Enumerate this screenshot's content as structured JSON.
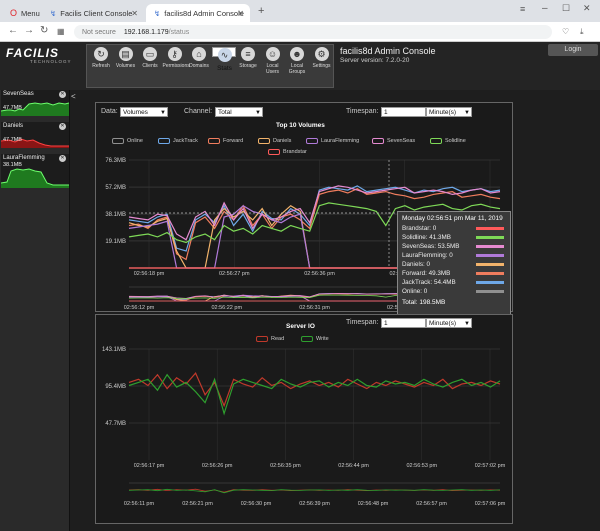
{
  "browser": {
    "tabs": [
      {
        "label": "Menu"
      },
      {
        "label": "Facilis Client Console"
      },
      {
        "label": "facilis8d Admin Console"
      }
    ],
    "new_tab": "+",
    "url_security": "Not secure",
    "url_host": "192.168.1.179",
    "url_path": "/status"
  },
  "header": {
    "logo": "FACILIS",
    "logo_sub": "TECHNOLOGY",
    "title": "facilis8d Admin Console",
    "version": "Server version: 7.2.0-20",
    "login": "Login",
    "tools": [
      {
        "label": "Refresh",
        "icon": "refresh-icon",
        "glyph": "↻"
      },
      {
        "label": "Volumes",
        "icon": "volumes-icon",
        "glyph": "▤"
      },
      {
        "label": "Clients",
        "icon": "clients-icon",
        "glyph": "▭"
      },
      {
        "label": "Permissions",
        "icon": "key-icon",
        "glyph": "⚷"
      },
      {
        "label": "Domains",
        "icon": "domains-icon",
        "glyph": "⌂"
      },
      {
        "label": "Stats",
        "icon": "stats-icon",
        "glyph": "∿"
      },
      {
        "label": "Storage",
        "icon": "storage-icon",
        "glyph": "≡"
      },
      {
        "label": "Local Users",
        "icon": "local-users-icon",
        "glyph": "☺"
      },
      {
        "label": "Local Groups",
        "icon": "local-groups-icon",
        "glyph": "☻"
      },
      {
        "label": "Settings",
        "icon": "settings-icon",
        "glyph": "⚙"
      }
    ]
  },
  "sidebar": {
    "items": [
      {
        "name": "SevenSeas",
        "value": "47.7MB"
      },
      {
        "name": "Daniels",
        "value": "47.7MB"
      },
      {
        "name": "LauraFlemming",
        "value": "38.1MB"
      }
    ],
    "collapse": "<"
  },
  "volumes_panel": {
    "data_label": "Data:",
    "data_value": "Volumes",
    "channel_label": "Channel:",
    "channel_value": "Total",
    "timespan_label": "Timespan:",
    "timespan_value": "1",
    "timespan_unit": "Minute(s)",
    "tooltip": {
      "title": "Monday 02:56:51 pm Mar 11, 2019",
      "rows": [
        {
          "text": "Brandstar: 0",
          "color": "#ff5a5a"
        },
        {
          "text": "Solidline: 41.3MB",
          "color": "#7ed957"
        },
        {
          "text": "SevenSeas: 53.5MB",
          "color": "#e58ad0"
        },
        {
          "text": "LauraFlemming: 0",
          "color": "#b07ad9"
        },
        {
          "text": "Daniels: 0",
          "color": "#f2b36b"
        },
        {
          "text": "Forward: 49.3MB",
          "color": "#f07d5e"
        },
        {
          "text": "JackTrack: 54.4MB",
          "color": "#6ea8e8"
        },
        {
          "text": "Online: 0",
          "color": "#909090"
        }
      ],
      "total": "Total: 198.5MB"
    }
  },
  "io_panel": {
    "timespan_label": "Timespan:",
    "timespan_value": "1",
    "timespan_unit": "Minute(s)"
  },
  "chart_data": [
    {
      "type": "line",
      "title": "Top 10 Volumes",
      "y_ticks": [
        "76.3MB",
        "57.2MB",
        "38.1MB",
        "19.1MB"
      ],
      "y_tick_values": [
        76.3,
        57.2,
        38.1,
        19.1
      ],
      "ylim": [
        0,
        76.3
      ],
      "x_ticks": [
        "02:56:18 pm",
        "02:56:27 pm",
        "02:56:36 pm",
        "02:56:45 pm",
        "02:56:54 pm"
      ],
      "overview_x_ticks": [
        "02:56:12 pm",
        "02:56:22 pm",
        "02:56:31 pm",
        "02:56:40 pm",
        "02:56:49 pm"
      ],
      "series": [
        {
          "name": "Online",
          "color": "#909090",
          "values": [
            0,
            0,
            0,
            0,
            0,
            0,
            0,
            0,
            0,
            0,
            0,
            0,
            0,
            0,
            0,
            0,
            0,
            0,
            0,
            0,
            0,
            0,
            0,
            0,
            0,
            0,
            0,
            0,
            0,
            0,
            0,
            0,
            0,
            0,
            0,
            0,
            0,
            0,
            0,
            0
          ]
        },
        {
          "name": "JackTrack",
          "color": "#6ea8e8",
          "values": [
            34,
            33,
            32,
            36,
            38,
            14,
            12,
            34,
            38,
            32,
            44,
            30,
            38,
            26,
            40,
            35,
            34,
            42,
            38,
            30,
            55,
            57,
            56,
            55,
            58,
            54,
            55,
            56,
            57,
            55,
            53,
            55,
            54,
            56,
            57,
            54,
            55,
            56,
            54,
            55
          ]
        },
        {
          "name": "Forward",
          "color": "#f07d5e",
          "values": [
            30,
            31,
            28,
            34,
            36,
            10,
            6,
            32,
            36,
            28,
            40,
            34,
            44,
            30,
            38,
            28,
            36,
            38,
            34,
            28,
            52,
            54,
            55,
            53,
            56,
            52,
            53,
            54,
            52,
            51,
            49,
            50,
            52,
            53,
            54,
            50,
            51,
            52,
            50,
            49
          ]
        },
        {
          "name": "Daniels",
          "color": "#f2b36b",
          "values": [
            32,
            30,
            29,
            33,
            35,
            12,
            0,
            0,
            0,
            34,
            42,
            36,
            40,
            34,
            42,
            30,
            38,
            44,
            40,
            0,
            0,
            0,
            0,
            0,
            0,
            0,
            0,
            0,
            0,
            0,
            0,
            0,
            0,
            0,
            0,
            0,
            0,
            0,
            0,
            0
          ]
        },
        {
          "name": "LauraFlemming",
          "color": "#b07ad9",
          "values": [
            28,
            29,
            30,
            31,
            33,
            0,
            0,
            0,
            0,
            0,
            36,
            38,
            44,
            40,
            38,
            34,
            32,
            36,
            38,
            0,
            0,
            0,
            0,
            0,
            0,
            0,
            0,
            0,
            0,
            0,
            0,
            0,
            0,
            0,
            0,
            0,
            0,
            0,
            0,
            0
          ]
        },
        {
          "name": "SevenSeas",
          "color": "#e58ad0",
          "values": [
            36,
            35,
            34,
            38,
            37,
            24,
            20,
            36,
            40,
            30,
            46,
            34,
            42,
            28,
            38,
            34,
            36,
            40,
            42,
            32,
            54,
            56,
            58,
            57,
            55,
            53,
            54,
            55,
            56,
            57,
            53,
            54,
            55,
            54,
            52,
            53,
            55,
            56,
            53,
            54
          ]
        },
        {
          "name": "Solidline",
          "color": "#7ed957",
          "values": [
            22,
            23,
            24,
            22,
            25,
            20,
            18,
            22,
            24,
            20,
            30,
            26,
            28,
            24,
            30,
            28,
            26,
            30,
            28,
            26,
            44,
            46,
            45,
            44,
            43,
            42,
            40,
            30,
            42,
            44,
            41,
            43,
            44,
            45,
            42,
            41,
            44,
            45,
            43,
            42
          ]
        },
        {
          "name": "Brandstar",
          "color": "#ff5a5a",
          "values": [
            0,
            0,
            0,
            0,
            0,
            0,
            0,
            0,
            0,
            0,
            0,
            0,
            0,
            0,
            0,
            0,
            0,
            0,
            0,
            0,
            0,
            0,
            0,
            0,
            0,
            0,
            0,
            0,
            0,
            0,
            0,
            0,
            0,
            0,
            0,
            0,
            0,
            0,
            0,
            0
          ]
        }
      ]
    },
    {
      "type": "line",
      "title": "Server IO",
      "y_ticks": [
        "143.1MB",
        "95.4MB",
        "47.7MB"
      ],
      "y_tick_values": [
        143.1,
        95.4,
        47.7
      ],
      "ylim": [
        0,
        143.1
      ],
      "x_ticks": [
        "02:56:17 pm",
        "02:56:26 pm",
        "02:56:35 pm",
        "02:56:44 pm",
        "02:56:53 pm",
        "02:57:02 pm"
      ],
      "overview_x_ticks": [
        "02:56:11 pm",
        "02:56:21 pm",
        "02:56:30 pm",
        "02:56:39 pm",
        "02:56:48 pm",
        "02:56:57 pm",
        "02:57:06 pm"
      ],
      "series": [
        {
          "name": "Read",
          "color": "#c0392b",
          "values": [
            100,
            104,
            96,
            110,
            92,
            106,
            98,
            112,
            84,
            100,
            70,
            104,
            98,
            94,
            106,
            96,
            100,
            92,
            98,
            102,
            96,
            100,
            94,
            104,
            98,
            92,
            100,
            96,
            102,
            98,
            94,
            100,
            96,
            104,
            92,
            98,
            100,
            96,
            102,
            98
          ]
        },
        {
          "name": "Write",
          "color": "#2e9e2e",
          "values": [
            96,
            100,
            104,
            90,
            110,
            94,
            100,
            88,
            74,
            104,
            60,
            98,
            104,
            100,
            96,
            92,
            104,
            98,
            94,
            100,
            102,
            94,
            100,
            96,
            104,
            96,
            94,
            102,
            98,
            100,
            96,
            104,
            98,
            94,
            100,
            104,
            96,
            100,
            94,
            102
          ]
        }
      ]
    }
  ]
}
